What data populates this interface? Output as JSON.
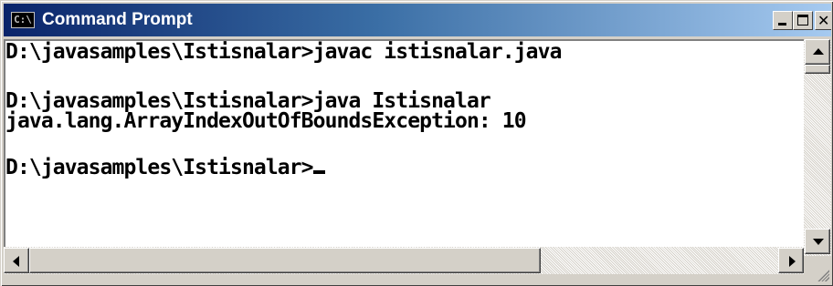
{
  "window": {
    "title": "Command Prompt",
    "icon_name": "console-icon",
    "icon_label": "C:\\",
    "title_gradient": [
      "#0a246a",
      "#a6caf0"
    ]
  },
  "controls": {
    "minimize_icon": "minimize-icon",
    "maximize_icon": "maximize-icon",
    "close_icon": "close-icon",
    "close_glyph": "✕"
  },
  "console": {
    "background": "#ffffff",
    "text_color": "#000000",
    "lines": [
      "D:\\javasamples\\Istisnalar>javac istisnalar.java",
      "",
      "D:\\javasamples\\Istisnalar>java Istisnalar",
      "java.lang.ArrayIndexOutOfBoundsException: 10",
      "",
      "D:\\javasamples\\Istisnalar>"
    ]
  },
  "scrollbars": {
    "vertical": {
      "up_icon": "arrow-up-icon",
      "down_icon": "arrow-down-icon",
      "position": 0
    },
    "horizontal": {
      "left_icon": "arrow-left-icon",
      "right_icon": "arrow-right-icon",
      "position": 0
    }
  }
}
